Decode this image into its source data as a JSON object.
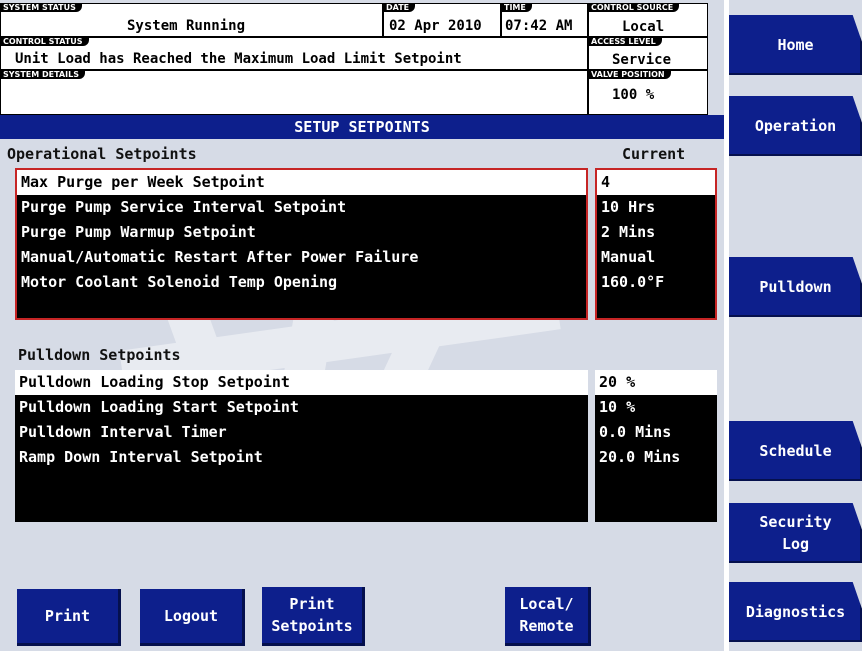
{
  "header": {
    "system_status": {
      "tag": "SYSTEM STATUS",
      "value": "System Running"
    },
    "date": {
      "tag": "DATE",
      "value": "02 Apr 2010"
    },
    "time": {
      "tag": "TIME",
      "value": "07:42 AM"
    },
    "control_source": {
      "tag": "CONTROL SOURCE",
      "value": "Local"
    },
    "control_status": {
      "tag": "CONTROL STATUS",
      "value": "Unit Load has Reached the Maximum Load Limit Setpoint"
    },
    "access_level": {
      "tag": "ACCESS LEVEL",
      "value": "Service"
    },
    "system_details": {
      "tag": "SYSTEM DETAILS",
      "value": ""
    },
    "valve_position": {
      "tag": "VALVE POSITION",
      "value": "100 %"
    }
  },
  "title": "SETUP SETPOINTS",
  "operational": {
    "heading": "Operational Setpoints",
    "current_heading": "Current",
    "rows": [
      {
        "label": "Max Purge per Week Setpoint",
        "value": "4"
      },
      {
        "label": "Purge Pump Service Interval Setpoint",
        "value": "10 Hrs"
      },
      {
        "label": "Purge Pump Warmup Setpoint",
        "value": "2 Mins"
      },
      {
        "label": "Manual/Automatic Restart After Power Failure",
        "value": "Manual"
      },
      {
        "label": "Motor Coolant Solenoid Temp Opening",
        "value": "160.0°F"
      }
    ]
  },
  "pulldown": {
    "heading": "Pulldown Setpoints",
    "rows": [
      {
        "label": "Pulldown Loading Stop Setpoint",
        "value": "20 %"
      },
      {
        "label": "Pulldown Loading Start Setpoint",
        "value": "10 %"
      },
      {
        "label": "Pulldown Interval Timer",
        "value": "0.0 Mins"
      },
      {
        "label": "Ramp Down Interval Setpoint",
        "value": "20.0 Mins"
      }
    ]
  },
  "side_buttons": {
    "home": "Home",
    "operation": "Operation",
    "pulldown": "Pulldown",
    "schedule": "Schedule",
    "security_log_1": "Security",
    "security_log_2": "Log",
    "diagnostics": "Diagnostics"
  },
  "bottom_buttons": {
    "print": "Print",
    "logout": "Logout",
    "print_setpoints_1": "Print",
    "print_setpoints_2": "Setpoints",
    "local_remote_1": "Local/",
    "local_remote_2": "Remote"
  },
  "colors": {
    "accent": "#0d1f8c",
    "highlight_border": "#c62525",
    "background": "#d6dbe6"
  }
}
